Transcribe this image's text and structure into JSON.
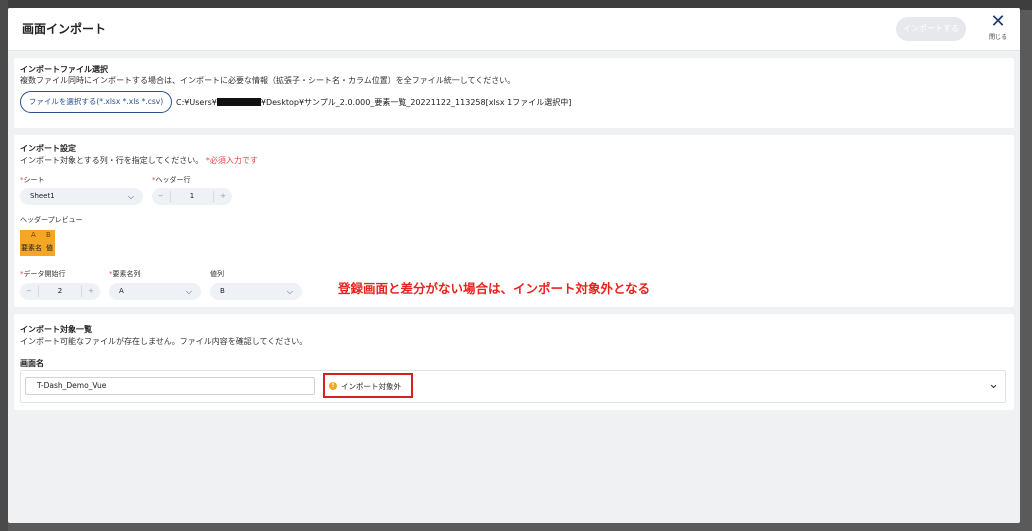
{
  "modal": {
    "title": "画面インポート",
    "import_button": "インポートする",
    "close_label": "閉じる"
  },
  "file_section": {
    "title": "インポートファイル選択",
    "description": "複数ファイル同時にインポートする場合は、インポートに必要な情報（拡張子・シート名・カラム位置）を全ファイル統一してください。",
    "select_button": "ファイルを選択する(*.xlsx *.xls *.csv)",
    "path_prefix": "C:¥Users¥",
    "path_suffix": "¥Desktop¥サンプル_2.0.000_要素一覧_20221122_113258[xlsx 1ファイル選択中]"
  },
  "settings_section": {
    "title": "インポート設定",
    "description": "インポート対象とする列・行を指定してください。",
    "required_note": "*必須入力です",
    "sheet": {
      "label": "シート",
      "value": "Sheet1"
    },
    "header_row": {
      "label": "ヘッダー行",
      "value": "1"
    },
    "preview_label": "ヘッダープレビュー",
    "preview": {
      "columns": [
        "A",
        "B"
      ],
      "cells": [
        "要素名",
        "値"
      ]
    },
    "data_start_row": {
      "label": "データ開始行",
      "value": "2"
    },
    "element_name_col": {
      "label": "要素名列",
      "value": "A"
    },
    "value_col": {
      "label": "値列",
      "value": "B"
    },
    "annotation": "登録画面と差分がない場合は、インポート対象外となる"
  },
  "list_section": {
    "title": "インポート対象一覧",
    "description": "インポート可能なファイルが存在しません。ファイル内容を確認してください。",
    "column_header": "画面名",
    "rows": [
      {
        "name": "T-Dash_Demo_Vue",
        "status": "インポート対象外"
      }
    ]
  },
  "colors": {
    "primary": "#2a4f8f",
    "required": "#e04a4a",
    "annotation": "#e8231f",
    "warning": "#f5a623"
  }
}
